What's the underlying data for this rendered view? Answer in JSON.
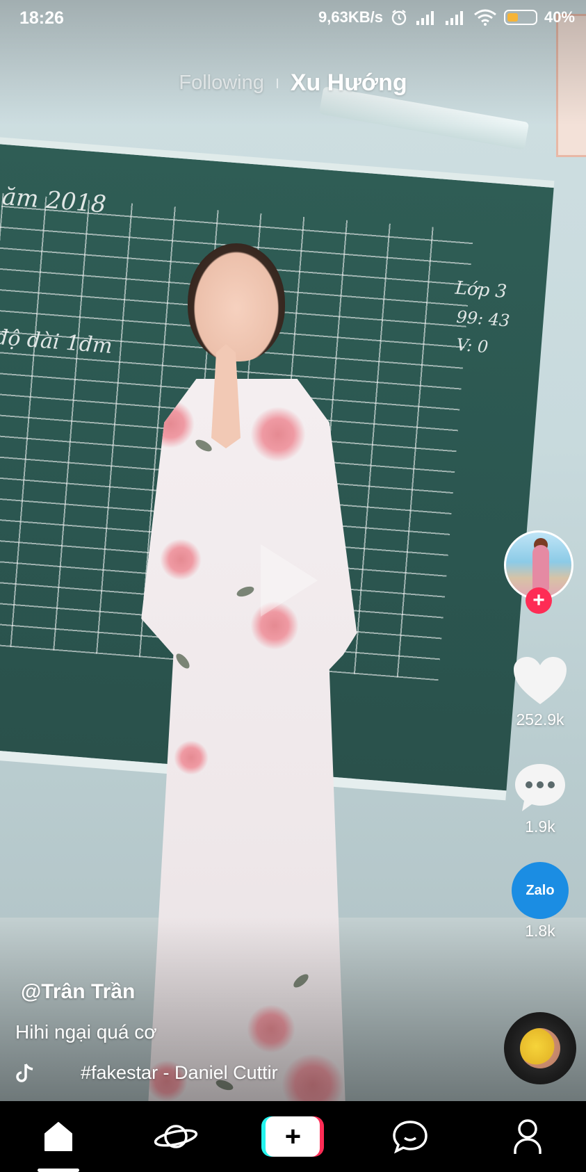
{
  "status_bar": {
    "time": "18:26",
    "network_speed": "9,63KB/s",
    "battery_percent": "40%",
    "battery_level": 0.4,
    "icons": [
      "alarm-icon",
      "signal-icon",
      "signal-icon",
      "wifi-icon",
      "battery-icon"
    ],
    "battery_color": "#f6b437"
  },
  "top_tabs": {
    "following": "Following",
    "trending": "Xu Hướng",
    "active": "trending"
  },
  "video": {
    "author": "@Trân Trần",
    "caption": "Hihi ngại quá cơ",
    "music": "#fakestar - Daniel Cuttir",
    "chalk_text": {
      "board_title": "ăm 2018",
      "label_left": "độ dài 1dm",
      "class_note": "Lớp 3",
      "note_line2": "99: 43",
      "note_line3": "V: 0"
    }
  },
  "actions": {
    "likes": "252.9k",
    "comments": "1.9k",
    "shares": "1.8k",
    "share_app_label": "Zalo",
    "follow_color": "#fe2c55",
    "zalo_color": "#1b8de3"
  },
  "bottom_nav": {
    "items": [
      "home-icon",
      "discover-icon",
      "create-icon",
      "inbox-icon",
      "profile-icon"
    ],
    "active": "home-icon",
    "accent_cyan": "#25f4ee",
    "accent_red": "#fe2c55"
  }
}
